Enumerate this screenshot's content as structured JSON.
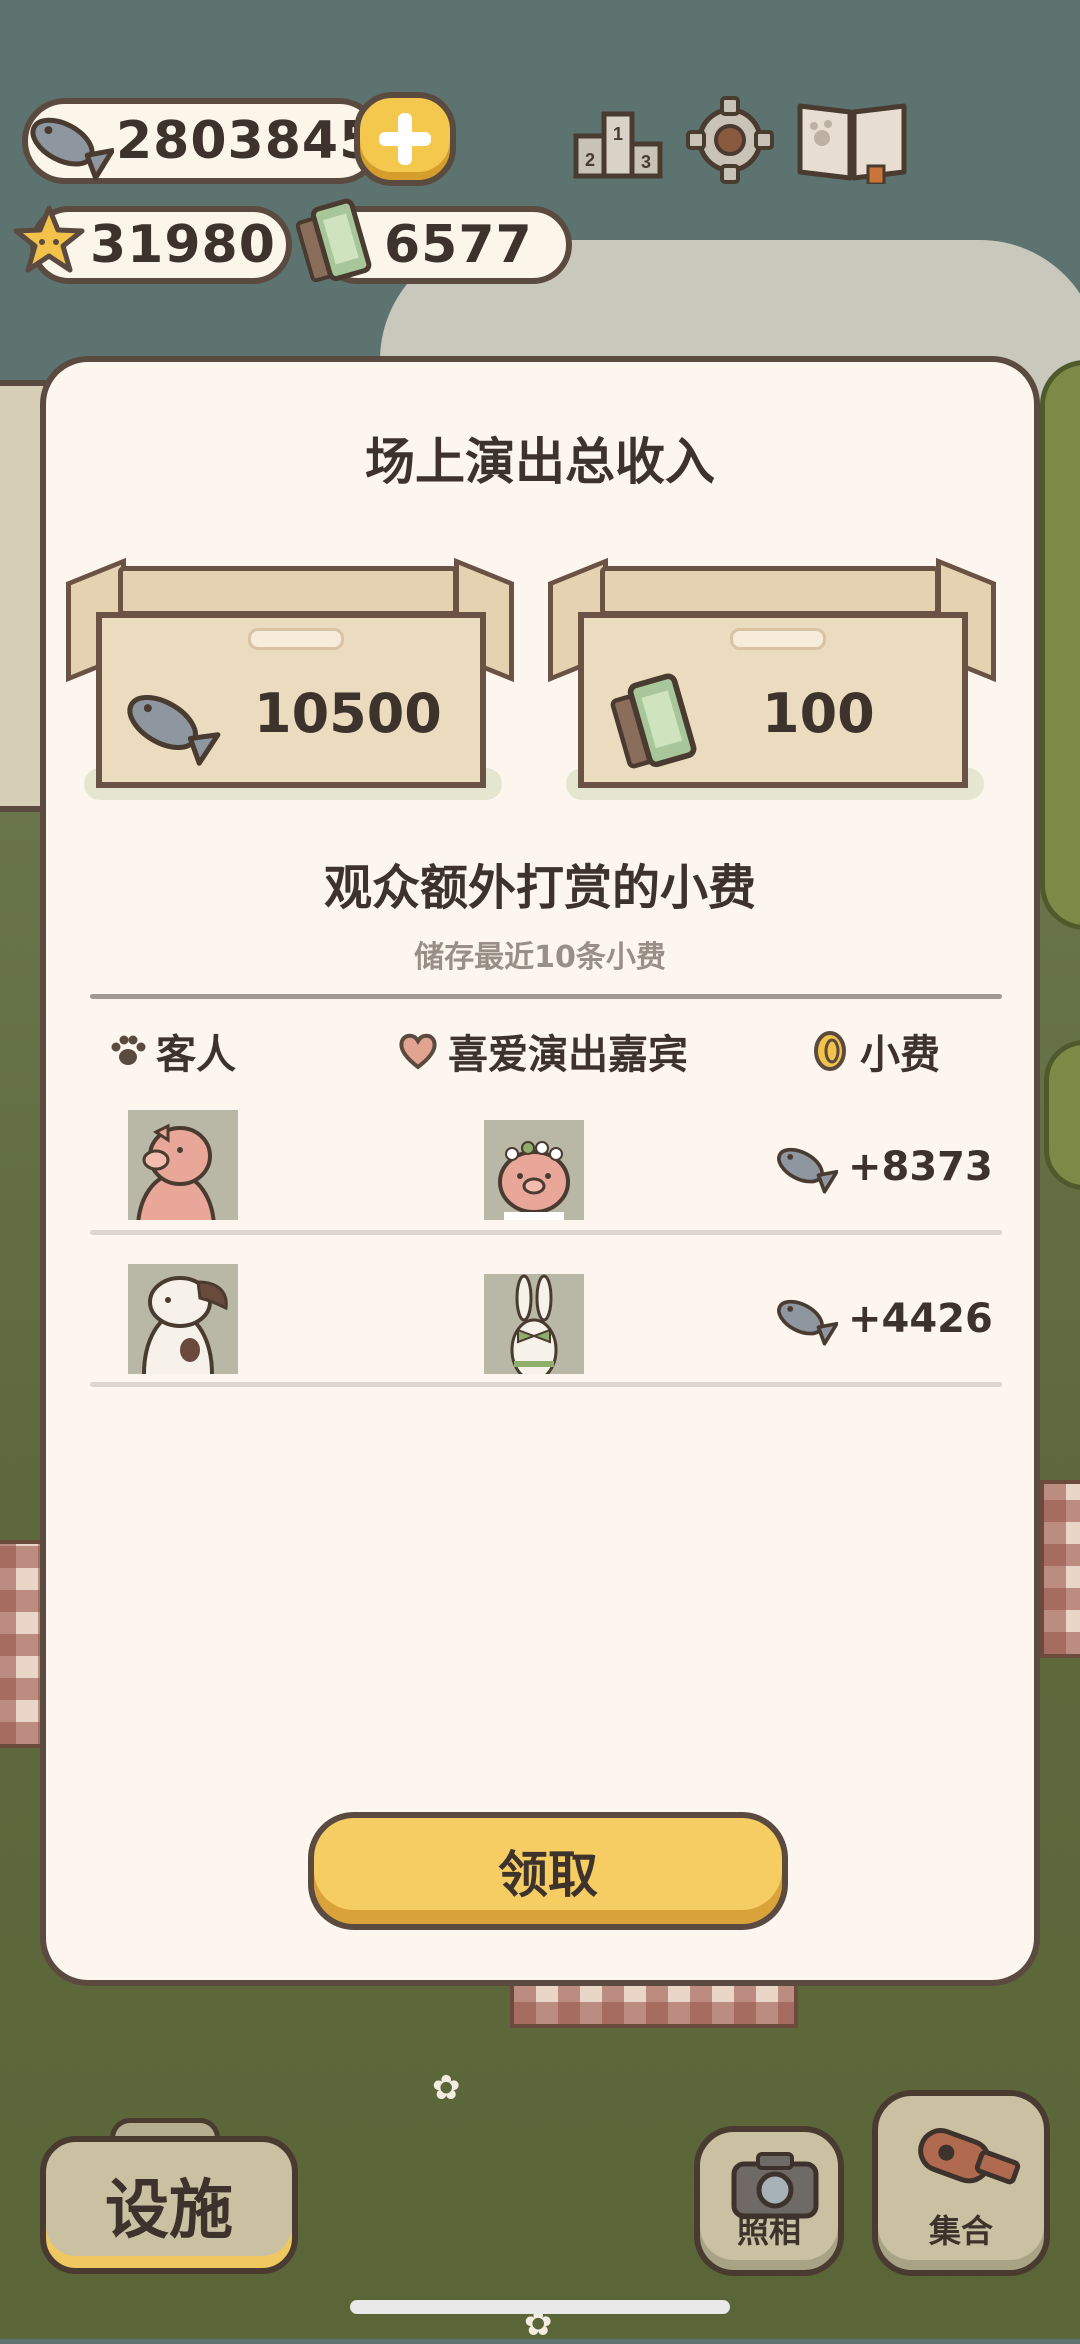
{
  "currency": {
    "fish": "2803845",
    "stars": "31980",
    "tickets": "6577"
  },
  "top_icons": [
    "ranking-icon",
    "settings-gear-icon",
    "book-icon"
  ],
  "modal": {
    "title": "场上演出总收入",
    "income_fish": "10500",
    "income_tickets": "100",
    "tips_title": "观众额外打赏的小费",
    "tips_note": "储存最近10条小费",
    "columns": {
      "guest": "客人",
      "favorite": "喜爱演出嘉宾",
      "tip": "小费"
    },
    "rows": [
      {
        "guest": "pig",
        "favorite": "pig-with-flower-crown",
        "tip": "+8373"
      },
      {
        "guest": "spotted-dog",
        "favorite": "white-rabbit",
        "tip": "+4426"
      }
    ],
    "claim_label": "领取"
  },
  "bottom": {
    "facility_label": "设施",
    "photo_label": "照相",
    "gather_label": "集合"
  },
  "colors": {
    "accent_yellow": "#f5cd63",
    "panel_bg": "#fcf6ee",
    "outline": "#5b4a40"
  }
}
